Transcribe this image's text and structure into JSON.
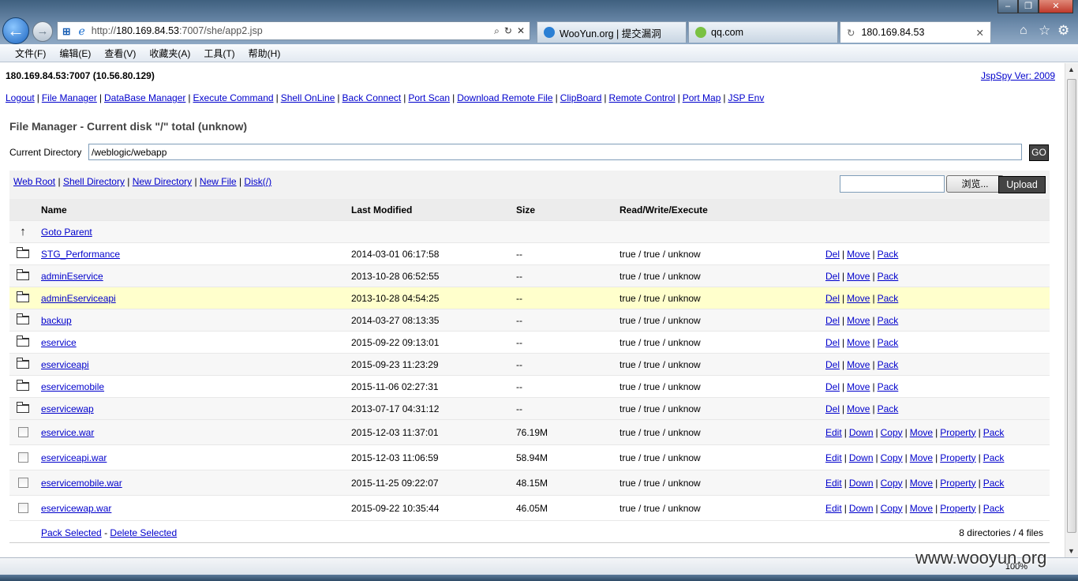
{
  "browser": {
    "url_prefix": "http://",
    "url_host": "180.169.84.53",
    "url_rest": ":7007/she/app2.jsp",
    "tabs": [
      {
        "label": "WooYun.org | 提交漏洞"
      },
      {
        "label": "qq.com"
      },
      {
        "label": "180.169.84.53"
      }
    ],
    "menu": [
      "文件(F)",
      "编辑(E)",
      "查看(V)",
      "收藏夹(A)",
      "工具(T)",
      "帮助(H)"
    ],
    "zoom": "100%"
  },
  "header": {
    "host": "180.169.84.53:7007 (10.56.80.129)",
    "version": "JspSpy Ver: 2009"
  },
  "nav": [
    "Logout",
    "File Manager",
    "DataBase Manager",
    "Execute Command",
    "Shell OnLine",
    "Back Connect",
    "Port Scan",
    "Download Remote File",
    "ClipBoard",
    "Remote Control",
    "Port Map",
    "JSP Env"
  ],
  "file_manager": {
    "title": "File Manager - Current disk \"/\" total (unknow)",
    "current_dir_label": "Current Directory",
    "current_dir": "/weblogic/webapp",
    "go_label": "GO",
    "toolbar_links": [
      "Web Root",
      "Shell Directory",
      "New Directory",
      "New File",
      "Disk(/)"
    ],
    "browse_label": "浏览...",
    "upload_label": "Upload",
    "columns": [
      "Name",
      "Last Modified",
      "Size",
      "Read/Write/Execute"
    ],
    "goto_parent": "Goto Parent",
    "directories": [
      {
        "name": "STG_Performance",
        "modified": "2014-03-01 06:17:58",
        "size": "--",
        "rwx": "true / true / unknow"
      },
      {
        "name": "adminEservice",
        "modified": "2013-10-28 06:52:55",
        "size": "--",
        "rwx": "true / true / unknow"
      },
      {
        "name": "adminEserviceapi",
        "modified": "2013-10-28 04:54:25",
        "size": "--",
        "rwx": "true / true / unknow"
      },
      {
        "name": "backup",
        "modified": "2014-03-27 08:13:35",
        "size": "--",
        "rwx": "true / true / unknow"
      },
      {
        "name": "eservice",
        "modified": "2015-09-22 09:13:01",
        "size": "--",
        "rwx": "true / true / unknow"
      },
      {
        "name": "eserviceapi",
        "modified": "2015-09-23 11:23:29",
        "size": "--",
        "rwx": "true / true / unknow"
      },
      {
        "name": "eservicemobile",
        "modified": "2015-11-06 02:27:31",
        "size": "--",
        "rwx": "true / true / unknow"
      },
      {
        "name": "eservicewap",
        "modified": "2013-07-17 04:31:12",
        "size": "--",
        "rwx": "true / true / unknow"
      }
    ],
    "dir_actions": [
      "Del",
      "Move",
      "Pack"
    ],
    "files": [
      {
        "name": "eservice.war",
        "modified": "2015-12-03 11:37:01",
        "size": "76.19M",
        "rwx": "true / true / unknow"
      },
      {
        "name": "eserviceapi.war",
        "modified": "2015-12-03 11:06:59",
        "size": "58.94M",
        "rwx": "true / true / unknow"
      },
      {
        "name": "eservicemobile.war",
        "modified": "2015-11-25 09:22:07",
        "size": "48.15M",
        "rwx": "true / true / unknow"
      },
      {
        "name": "eservicewap.war",
        "modified": "2015-09-22 10:35:44",
        "size": "46.05M",
        "rwx": "true / true / unknow"
      }
    ],
    "file_actions": [
      "Edit",
      "Down",
      "Copy",
      "Move",
      "Property",
      "Pack"
    ],
    "pack_selected": "Pack Selected",
    "footer_sep": "-",
    "delete_selected": "Delete Selected",
    "summary": "8 directories / 4 files"
  },
  "watermark": "www.wooyun.org"
}
